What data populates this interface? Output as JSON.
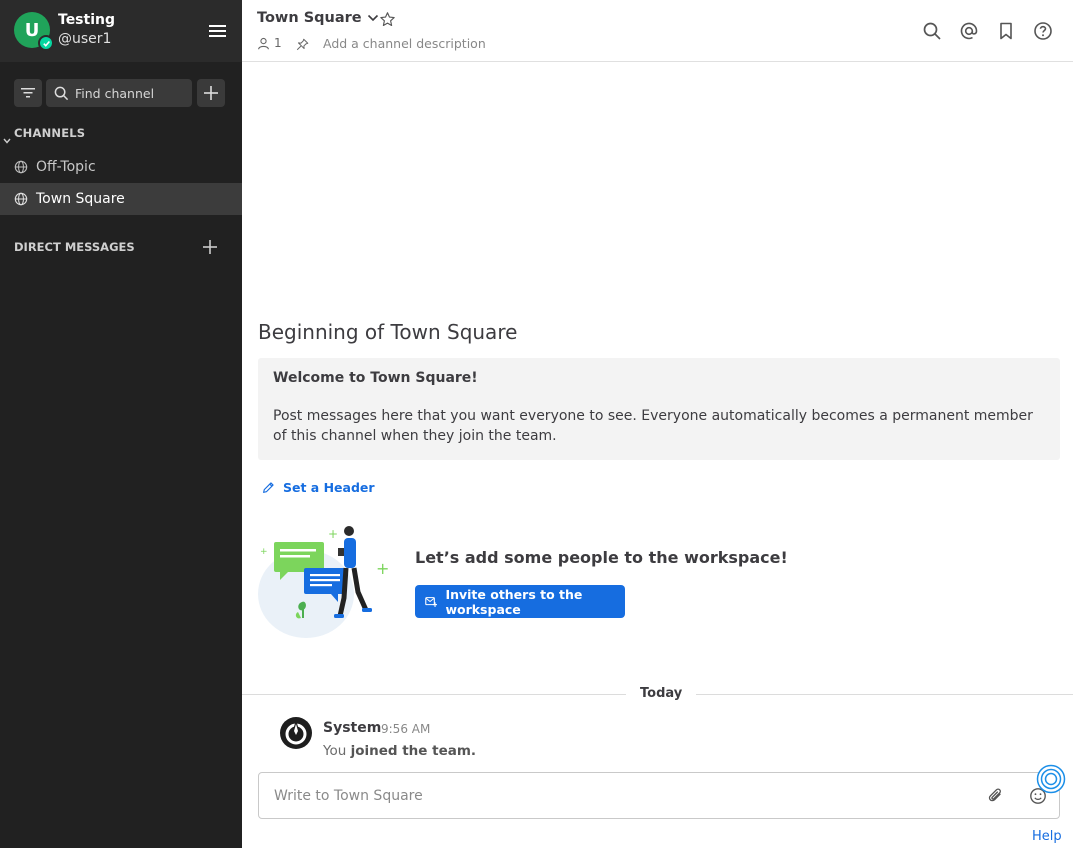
{
  "team": {
    "name": "Testing",
    "username": "@user1",
    "avatar_letter": "U",
    "avatar_color": "#20a35a"
  },
  "sidebar": {
    "find_channel_placeholder": "Find channel",
    "channels_header": "CHANNELS",
    "channels": [
      {
        "label": "Off-Topic",
        "icon": "globe-icon",
        "active": false
      },
      {
        "label": "Town Square",
        "icon": "globe-icon",
        "active": true
      }
    ],
    "dm_header": "DIRECT MESSAGES"
  },
  "channel": {
    "title": "Town Square",
    "member_count": "1",
    "description_placeholder": "Add a channel description"
  },
  "intro": {
    "title": "Beginning of Town Square",
    "welcome_title": "Welcome to Town Square!",
    "welcome_body": "Post messages here that you want everyone to see. Everyone automatically becomes a permanent member of this channel when they join the team.",
    "set_header": "Set a Header",
    "invite_title": "Let’s add some people to the workspace!",
    "invite_button": "Invite others to the workspace"
  },
  "feed": {
    "date_separator": "Today",
    "posts": [
      {
        "author": "System",
        "time": "9:56 AM",
        "message_prefix": "You ",
        "message_bold": "joined the team."
      }
    ]
  },
  "composer": {
    "placeholder": "Write to Town Square"
  },
  "footer": {
    "help": "Help"
  },
  "colors": {
    "sidebar_bg": "#212121",
    "accent": "#166de0",
    "online": "#06d6a0"
  }
}
